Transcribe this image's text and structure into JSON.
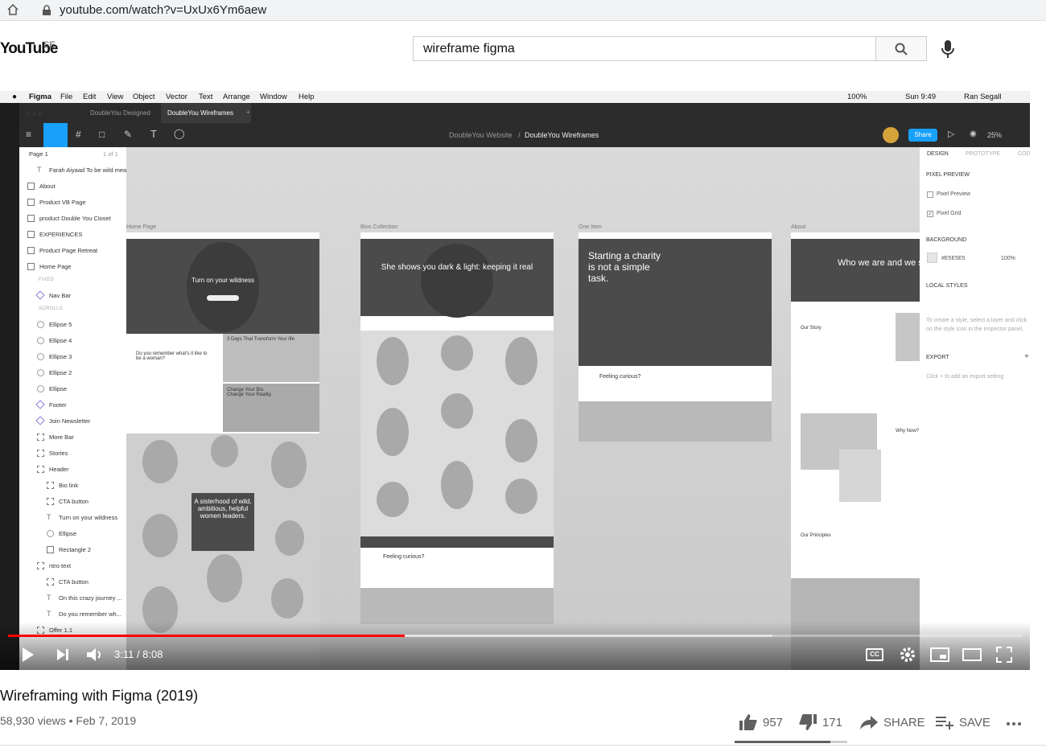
{
  "browser": {
    "url": "youtube.com/watch?v=UxUx6Ym6aew"
  },
  "header": {
    "logo": "YouTube",
    "region": "SE",
    "search_value": "wireframe figma"
  },
  "figma": {
    "menu": [
      "Figma",
      "File",
      "Edit",
      "View",
      "Object",
      "Vector",
      "Text",
      "Arrange",
      "Window",
      "Help"
    ],
    "status": {
      "battery": "100%",
      "clock": "Sun 9:49",
      "user": "Ran Segall"
    },
    "tabs": [
      "DoubleYou Designed",
      "DoubleYou Wireframes"
    ],
    "breadcrumb": {
      "project": "DoubleYou Website",
      "sep": "/",
      "file": "DoubleYou Wireframes"
    },
    "share_label": "Share",
    "zoom": "25%",
    "page": {
      "name": "Page 1",
      "count": "1 of 1"
    },
    "layers": [
      {
        "name": "Farah Aiyaad To be wild mean...",
        "kind": "text",
        "indent": 1
      },
      {
        "name": "About",
        "kind": "frame",
        "indent": 0
      },
      {
        "name": "Product VB Page",
        "kind": "frame",
        "indent": 0
      },
      {
        "name": "product Double You Closet",
        "kind": "frame",
        "indent": 0
      },
      {
        "name": "EXPERIENCES",
        "kind": "frame",
        "indent": 0
      },
      {
        "name": "Product Page Retreat",
        "kind": "frame",
        "indent": 0
      },
      {
        "name": "Home Page",
        "kind": "frame",
        "indent": 0
      },
      {
        "name": "FIXED",
        "kind": "section",
        "indent": 1
      },
      {
        "name": "Nav Bar",
        "kind": "component",
        "indent": 1
      },
      {
        "name": "SCROLLS",
        "kind": "section",
        "indent": 1
      },
      {
        "name": "Ellipse 5",
        "kind": "ellipse",
        "indent": 1
      },
      {
        "name": "Ellipse 4",
        "kind": "ellipse",
        "indent": 1
      },
      {
        "name": "Ellipse 3",
        "kind": "ellipse",
        "indent": 1
      },
      {
        "name": "Ellipse 2",
        "kind": "ellipse",
        "indent": 1
      },
      {
        "name": "Ellipse",
        "kind": "ellipse",
        "indent": 1
      },
      {
        "name": "Footer",
        "kind": "component",
        "indent": 1
      },
      {
        "name": "Join Newsletter",
        "kind": "component",
        "indent": 1
      },
      {
        "name": "More Bar",
        "kind": "group",
        "indent": 1
      },
      {
        "name": "Stories",
        "kind": "group",
        "indent": 1
      },
      {
        "name": "Header",
        "kind": "group",
        "indent": 1
      },
      {
        "name": "Bio link",
        "kind": "group",
        "indent": 2
      },
      {
        "name": "CTA button",
        "kind": "group",
        "indent": 2
      },
      {
        "name": "Turn on your wildness",
        "kind": "text",
        "indent": 2
      },
      {
        "name": "Ellipse",
        "kind": "ellipse",
        "indent": 2
      },
      {
        "name": "Rectangle 2",
        "kind": "rect",
        "indent": 2
      },
      {
        "name": "ntro text",
        "kind": "group",
        "indent": 1
      },
      {
        "name": "CTA button",
        "kind": "group",
        "indent": 2
      },
      {
        "name": "On this crazy journey ...",
        "kind": "text",
        "indent": 2
      },
      {
        "name": "Do you remember wh...",
        "kind": "text",
        "indent": 2
      },
      {
        "name": "Offer 1.1",
        "kind": "group",
        "indent": 1
      }
    ],
    "frames": {
      "home": {
        "label": "Home Page",
        "hero": "Turn on your wildness",
        "intro": "Do you remember what's it like to be a woman?",
        "days": "3 Days That Transform Your life",
        "bio": "Change Your Bio. Change Your Reality.",
        "sister": "A sisterhood of wild, ambitious, helpful women leaders."
      },
      "bios": {
        "label": "Bios Collection",
        "hero": "She shows you dark & light: keeping it real",
        "curious": "Feeling curious?"
      },
      "item": {
        "label": "One Item",
        "hero": "Starting a charity is not a simple task.",
        "curious": "Feeling curious?"
      },
      "about": {
        "label": "About",
        "hero": "Who we are and we stand for",
        "story": "Our Story",
        "why": "Why Now?",
        "principles": "Our Principles"
      }
    },
    "inspector": {
      "tabs": [
        "DESIGN",
        "PROTOTYPE",
        "CODE"
      ],
      "pixel_preview": "PIXEL PREVIEW",
      "pp_option": "Pixel Preview",
      "pg_option": "Pixel Grid",
      "background": "BACKGROUND",
      "bg_hex": "#E5E5E5",
      "bg_opacity": "100%",
      "local_styles": "LOCAL STYLES",
      "local_hint": "To create a style, select a layer and click on the style icon in the inspector panel.",
      "export": "EXPORT",
      "export_hint": "Click + to add an export setting"
    }
  },
  "player": {
    "time": "3:11 / 8:08",
    "progress": 0.3914,
    "buffered": 0.754
  },
  "video": {
    "title": "Wireframing with Figma (2019)",
    "meta": "58,930 views • Feb 7, 2019"
  },
  "actions": {
    "likes": "957",
    "dislikes": "171",
    "share": "SHARE",
    "save": "SAVE",
    "like_ratio": 0.848
  }
}
